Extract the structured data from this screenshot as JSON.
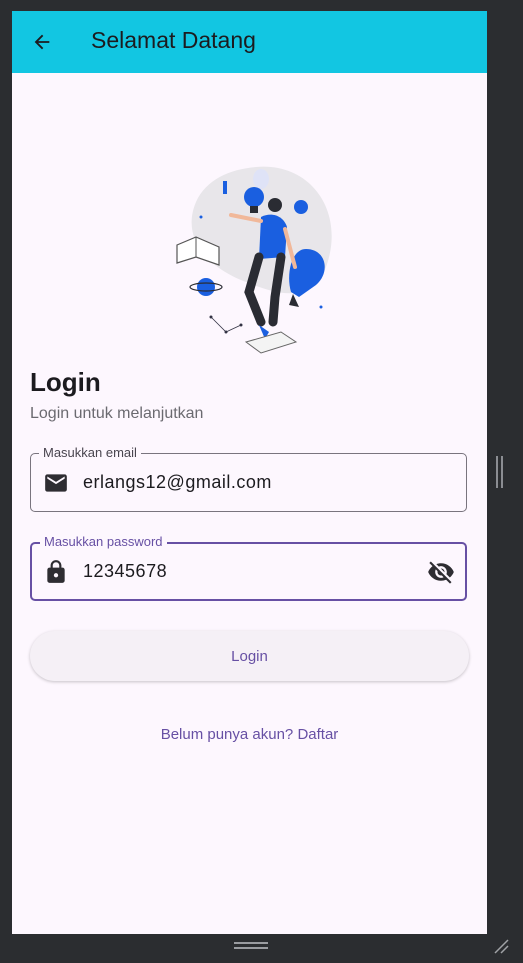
{
  "appbar": {
    "title": "Selamat Datang",
    "back_icon": "arrow-back-icon",
    "color": "#12c6e2"
  },
  "login": {
    "heading": "Login",
    "subtitle": "Login untuk melanjutkan",
    "email": {
      "label": "Masukkan email",
      "value": "erlangs12@gmail.com",
      "icon": "mail-icon"
    },
    "password": {
      "label": "Masukkan password",
      "value": "12345678",
      "icon": "lock-icon",
      "toggle_icon": "visibility-off-icon",
      "focused": true
    },
    "button_label": "Login",
    "register_link": "Belum punya akun? Daftar"
  },
  "colors": {
    "background": "#fdf7fe",
    "primary": "#6750a4",
    "illustration_accent": "#1a5fe0"
  }
}
